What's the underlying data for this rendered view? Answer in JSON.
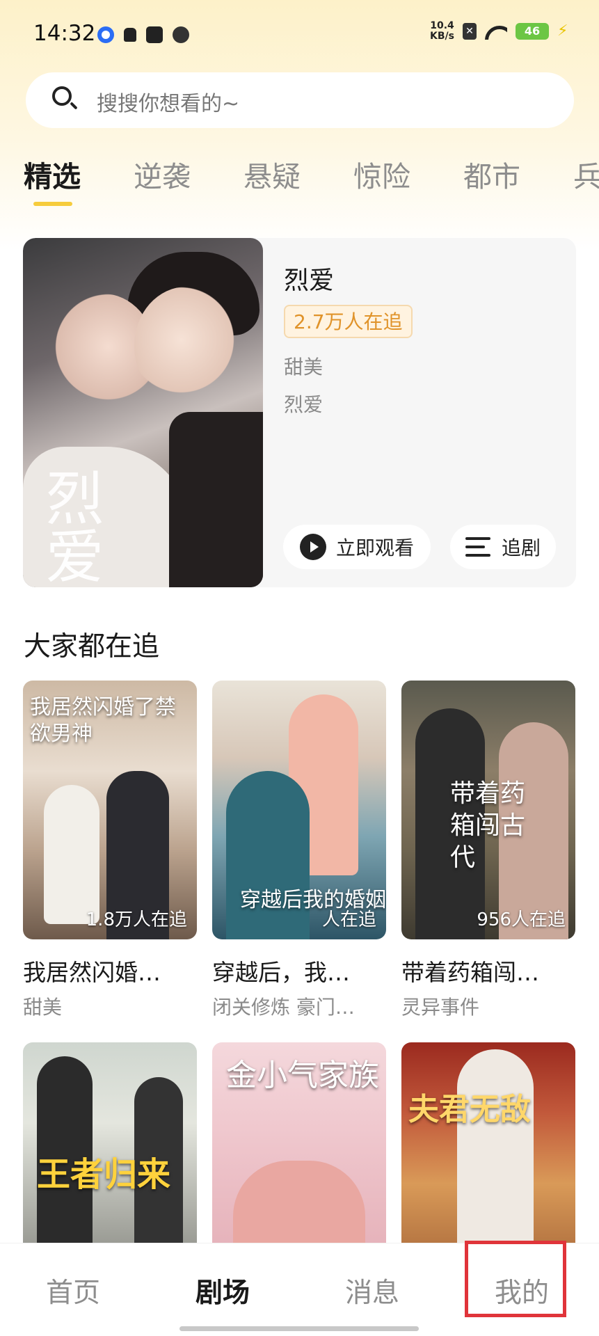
{
  "status_bar": {
    "time": "14:32",
    "net_speed_value": "10.4",
    "net_speed_unit": "KB/s",
    "battery": "46"
  },
  "search": {
    "placeholder": "搜搜你想看的~"
  },
  "tabs": [
    {
      "label": "精选",
      "active": true
    },
    {
      "label": "逆袭"
    },
    {
      "label": "悬疑"
    },
    {
      "label": "惊险"
    },
    {
      "label": "都市"
    },
    {
      "label": "兵"
    }
  ],
  "featured": {
    "title": "烈爱",
    "followers": "2.7万人在追",
    "genre": "甜美",
    "tag": "烈爱",
    "poster_text": "烈爱",
    "watch_label": "立即观看",
    "follow_label": "追剧"
  },
  "section": {
    "title": "大家都在追"
  },
  "cards": [
    {
      "title": "我居然闪婚…",
      "genre": "甜美",
      "followers": "1.8万人在追",
      "poster_text": "我居然闪婚了禁欲男神"
    },
    {
      "title": "穿越后，我…",
      "genre": "闭关修炼 豪门…",
      "followers": "人在追",
      "poster_text": "穿越后我的婚姻"
    },
    {
      "title": "带着药箱闯…",
      "genre": "灵异事件",
      "followers": "956人在追",
      "poster_text": "带着药箱闯古代"
    },
    {
      "title": "",
      "genre": "",
      "followers": "",
      "poster_text": "王者归来"
    },
    {
      "title": "",
      "genre": "",
      "followers": "",
      "poster_text": "金小气家族"
    },
    {
      "title": "",
      "genre": "",
      "followers": "",
      "poster_text": "夫君无敌"
    }
  ],
  "bottom_nav": [
    {
      "label": "首页"
    },
    {
      "label": "剧场",
      "active": true
    },
    {
      "label": "消息"
    },
    {
      "label": "我的"
    }
  ],
  "colors": {
    "accent_yellow": "#f6cc3c",
    "badge_orange": "#e0932a",
    "highlight_red": "#e0343a"
  }
}
